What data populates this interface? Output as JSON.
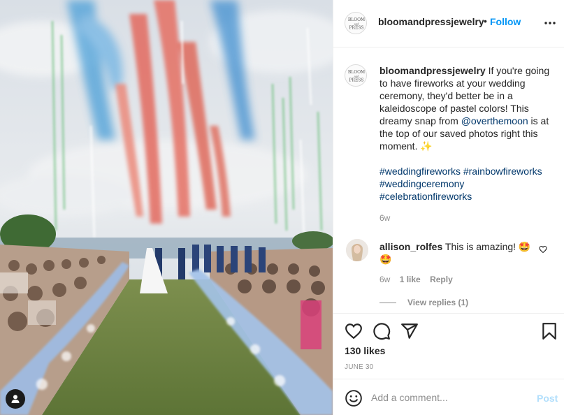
{
  "post": {
    "image_alt": "Wedding ceremony with pastel fireworks",
    "tag_icon": "person-icon"
  },
  "header": {
    "logo_text": [
      "BLOOM",
      "and",
      "PRESS"
    ],
    "username": "bloomandpressjewelry",
    "separator": "•",
    "follow_label": "Follow",
    "more_icon": "more-horizontal-icon"
  },
  "caption": {
    "username": "bloomandpressjewelry",
    "text_before": " If you're going to have fireworks at your wedding ceremony, they'd better be in a kaleidoscope of pastel colors! This dreamy snap from ",
    "mention": "@overthemoon",
    "text_after": " is at the top of our saved photos right this moment. ✨",
    "hashtags": [
      "#weddingfireworks",
      "#rainbowfireworks",
      "#weddingceremony",
      "#celebrationfireworks"
    ],
    "time": "6w"
  },
  "comment": {
    "username": "allison_rolfes",
    "text": " This is amazing! 🤩🤩",
    "time": "6w",
    "likes": "1 like",
    "reply_label": "Reply",
    "view_replies": "View replies (1)"
  },
  "actions": {
    "like_icon": "heart-icon",
    "comment_icon": "comment-icon",
    "share_icon": "share-icon",
    "save_icon": "bookmark-icon",
    "likes_label": "130 likes",
    "date_label": "JUNE 30"
  },
  "add_comment": {
    "placeholder": "Add a comment...",
    "post_label": "Post"
  },
  "colors": {
    "follow": "#0095f6",
    "link": "#00376b",
    "muted": "#8e8e8e",
    "post_disabled": "#b2dffc"
  }
}
